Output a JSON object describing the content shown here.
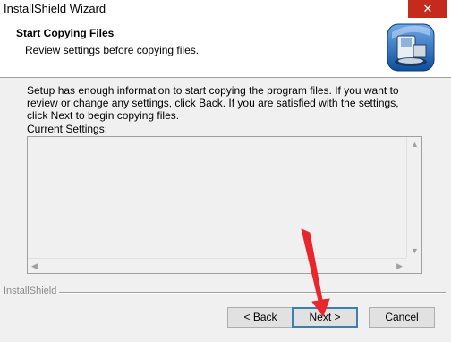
{
  "window": {
    "title": "InstallShield Wizard",
    "close_glyph": "✕"
  },
  "header": {
    "title": "Start Copying Files",
    "subtitle": "Review settings before copying files.",
    "icon": "installer-computer-icon"
  },
  "body": {
    "description": "Setup has enough information to start copying the program files.  If you want to review or change any settings, click Back.  If you are satisfied with the settings, click Next to begin copying files.",
    "settings_label": "Current Settings:",
    "settings_value": ""
  },
  "footer": {
    "brand": "InstallShield"
  },
  "buttons": {
    "back": "< Back",
    "next": "Next >",
    "cancel": "Cancel"
  },
  "colors": {
    "close_button": "#c42b1c",
    "annotation_arrow": "#e8262b",
    "default_button_border": "#3c7fb1"
  }
}
